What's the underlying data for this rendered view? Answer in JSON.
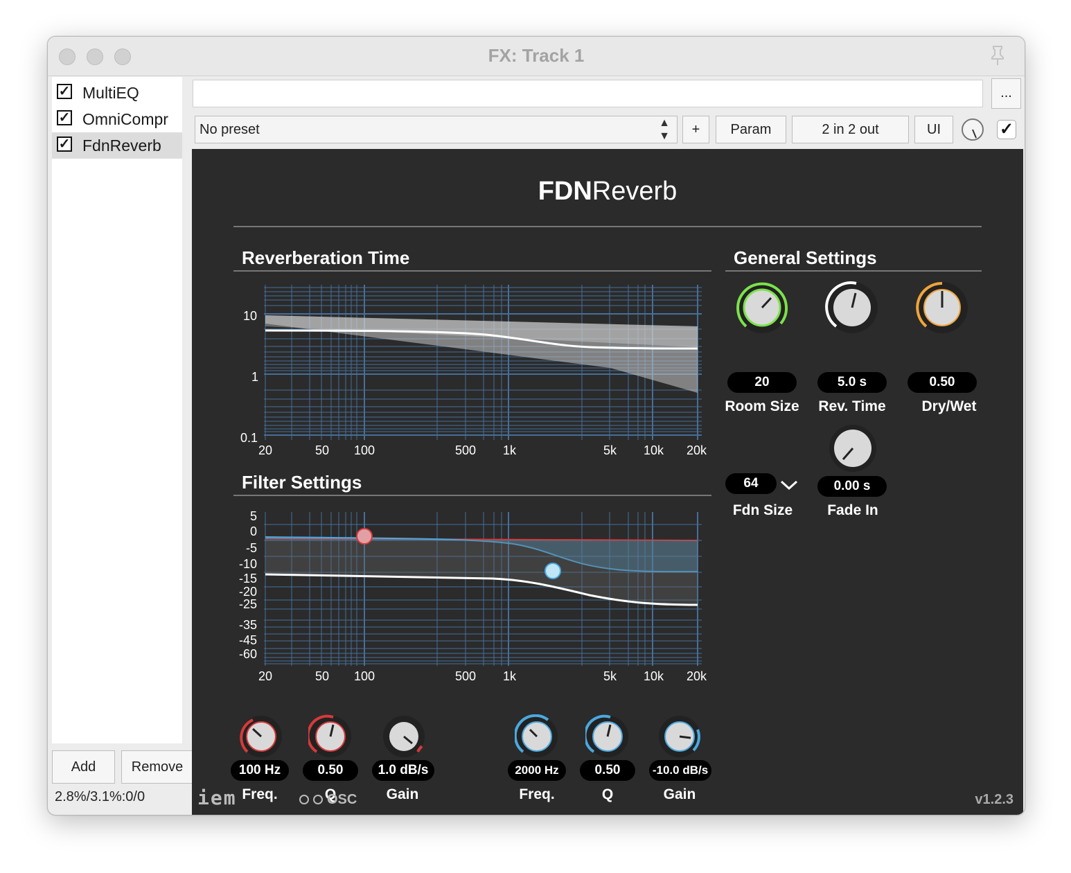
{
  "window": {
    "title": "FX: Track 1"
  },
  "fx_list": [
    {
      "label": "MultiEQ",
      "checked": true
    },
    {
      "label": "OmniCompr",
      "checked": true
    },
    {
      "label": "FdnReverb",
      "checked": true,
      "selected": true
    }
  ],
  "sidebar_buttons": {
    "add": "Add",
    "remove": "Remove"
  },
  "cpu_stats": "2.8%/3.1%:0/0",
  "toolbar": {
    "more": "...",
    "preset": "No preset",
    "plus": "+",
    "param": "Param",
    "io": "2 in 2 out",
    "ui": "UI"
  },
  "plugin": {
    "title_bold": "FDN",
    "title_light": "Reverb",
    "sections": {
      "reverb_time": "Reverberation Time",
      "general": "General Settings",
      "filter": "Filter Settings"
    },
    "reverb_graph": {
      "y_ticks": [
        "10",
        "1",
        "0.1"
      ],
      "x_ticks": [
        "20",
        "50",
        "100",
        "500",
        "1k",
        "5k",
        "10k",
        "20k"
      ]
    },
    "filter_graph": {
      "y_ticks": [
        "5",
        "0",
        "-5",
        "-10",
        "-15",
        "-20",
        "-25",
        "-35",
        "-45",
        "-60"
      ],
      "x_ticks": [
        "20",
        "50",
        "100",
        "500",
        "1k",
        "5k",
        "10k",
        "20k"
      ]
    },
    "general": {
      "room_size": {
        "value": "20",
        "label": "Room Size",
        "color": "#7be24a"
      },
      "rev_time": {
        "value": "5.0 s",
        "label": "Rev. Time",
        "color": "#ffffff"
      },
      "dry_wet": {
        "value": "0.50",
        "label": "Dry/Wet",
        "color": "#f0a43a"
      },
      "fdn_size": {
        "value": "64",
        "label": "Fdn Size"
      },
      "fade_in": {
        "value": "0.00 s",
        "label": "Fade In"
      }
    },
    "low_filter": {
      "color": "#d63a3a",
      "freq": {
        "value": "100 Hz",
        "label": "Freq."
      },
      "q": {
        "value": "0.50",
        "label": "Q"
      },
      "gain": {
        "value": "1.0 dB/s",
        "label": "Gain"
      }
    },
    "high_filter": {
      "color": "#4aa9e0",
      "freq": {
        "value": "2000 Hz",
        "label": "Freq."
      },
      "q": {
        "value": "0.50",
        "label": "Q"
      },
      "gain": {
        "value": "-10.0 dB/s",
        "label": "Gain"
      }
    },
    "footer": {
      "logo": "iem",
      "osc": "OSC",
      "version": "v1.2.3"
    }
  }
}
